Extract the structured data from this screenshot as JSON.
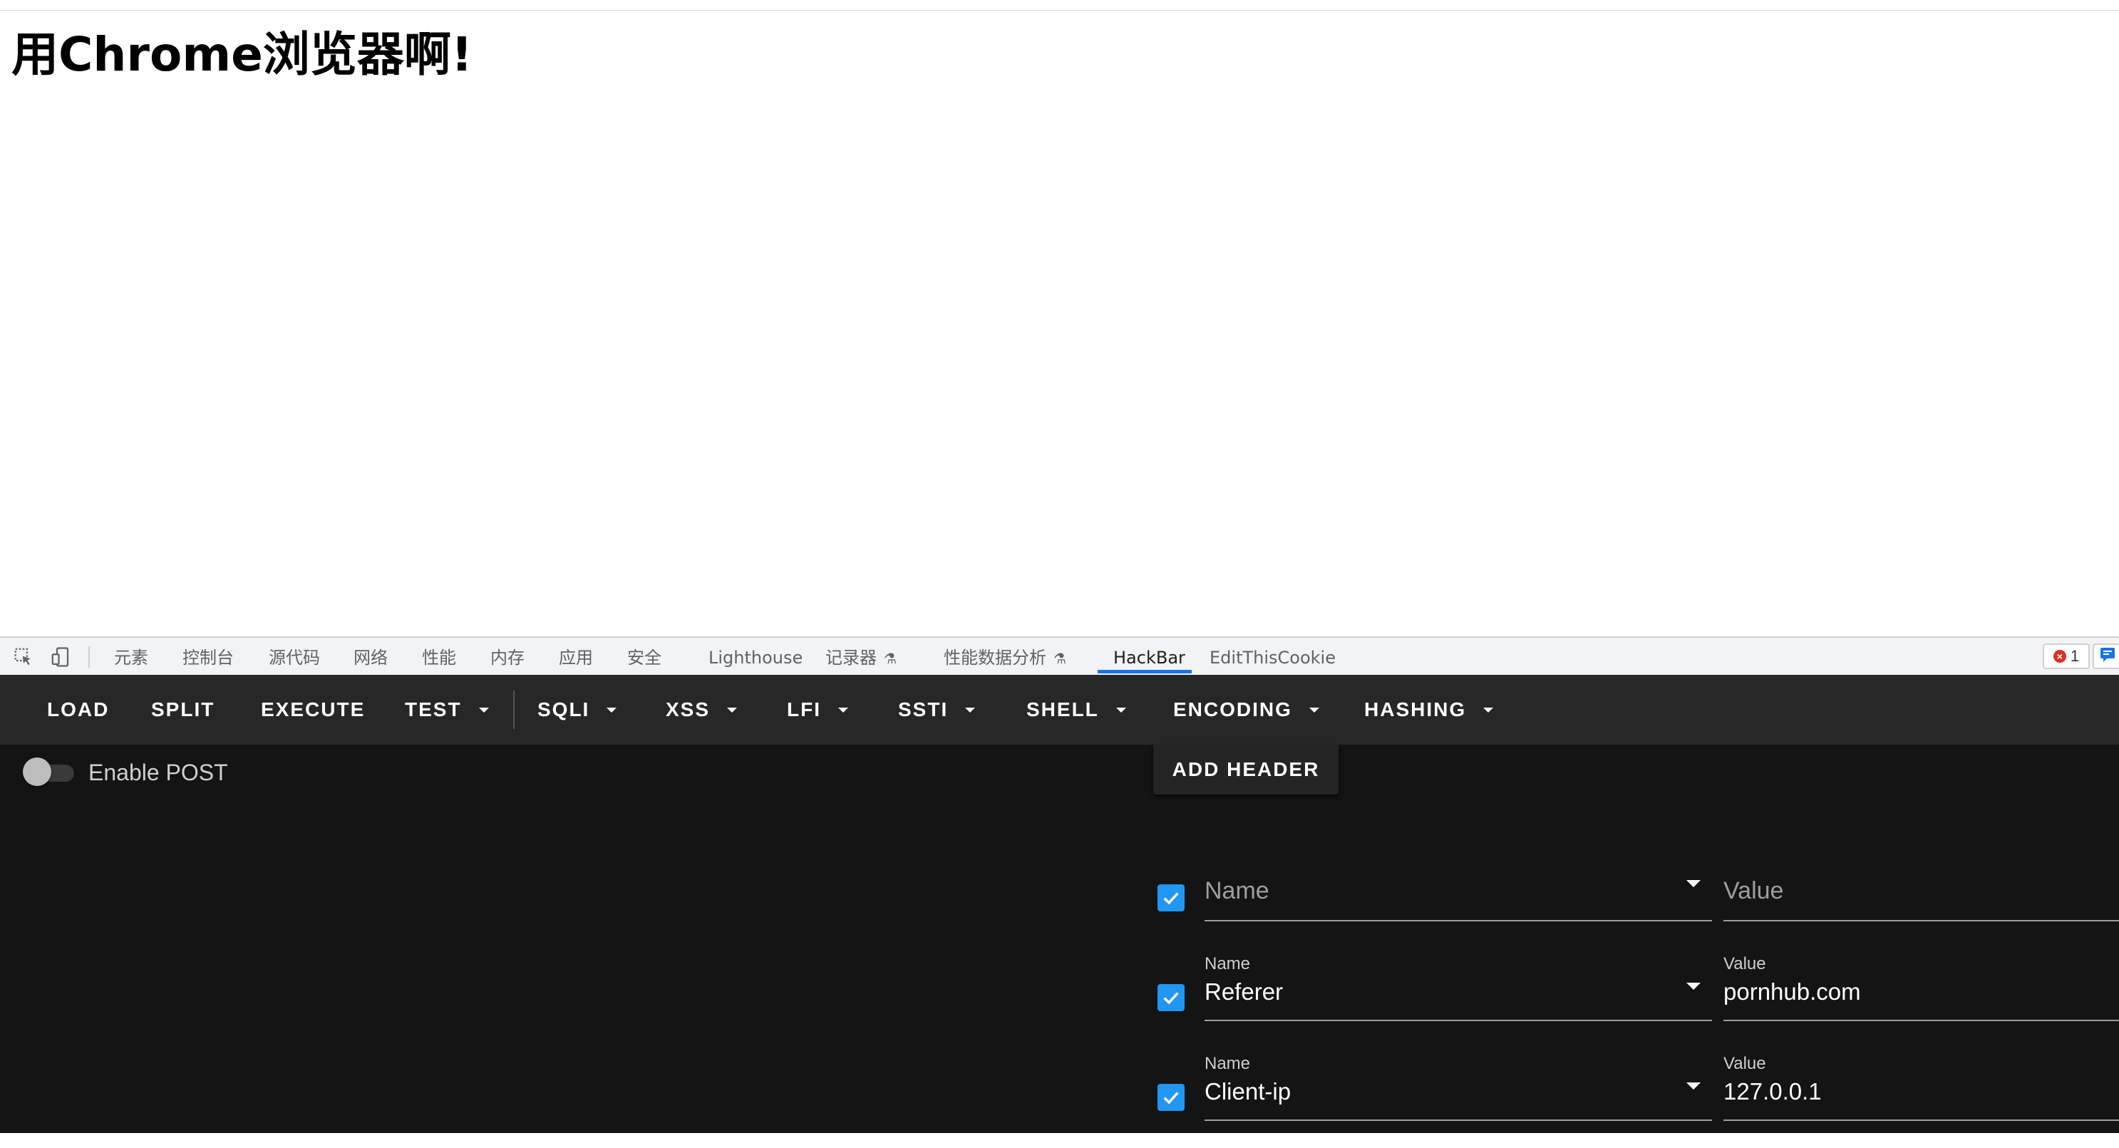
{
  "page": {
    "heading": "用Chrome浏览器啊!"
  },
  "devtools": {
    "tabs": [
      {
        "label": "元素",
        "icon": ""
      },
      {
        "label": "控制台",
        "icon": ""
      },
      {
        "label": "源代码",
        "icon": ""
      },
      {
        "label": "网络",
        "icon": ""
      },
      {
        "label": "性能",
        "icon": ""
      },
      {
        "label": "内存",
        "icon": ""
      },
      {
        "label": "应用",
        "icon": ""
      },
      {
        "label": "安全",
        "icon": ""
      },
      {
        "label": "Lighthouse",
        "icon": ""
      },
      {
        "label": "记录器",
        "icon": "flask-icon"
      },
      {
        "label": "性能数据分析",
        "icon": "flask-icon"
      },
      {
        "label": "HackBar",
        "icon": "",
        "active": true
      },
      {
        "label": "EditThisCookie",
        "icon": ""
      }
    ],
    "error_count": "1",
    "accent_color": "#1a73e8"
  },
  "hackbar": {
    "toolbar": {
      "load": "LOAD",
      "split": "SPLIT",
      "execute": "EXECUTE",
      "test": "TEST",
      "sqli": "SQLI",
      "xss": "XSS",
      "lfi": "LFI",
      "ssti": "SSTI",
      "shell": "SHELL",
      "encoding": "ENCODING",
      "hashing": "HASHING"
    },
    "enable_post": {
      "label": "Enable POST",
      "checked": false
    },
    "add_header_label": "ADD HEADER",
    "headers": [
      {
        "enabled": true,
        "name_label": "",
        "name": "",
        "name_placeholder": "Name",
        "value_label": "",
        "value": "",
        "value_placeholder": "Value"
      },
      {
        "enabled": true,
        "name_label": "Name",
        "name": "Referer",
        "value_label": "Value",
        "value": "pornhub.com"
      },
      {
        "enabled": true,
        "name_label": "Name",
        "name": "Client-ip",
        "value_label": "Value",
        "value": "127.0.0.1"
      }
    ],
    "checkbox_color": "#2196f3"
  }
}
